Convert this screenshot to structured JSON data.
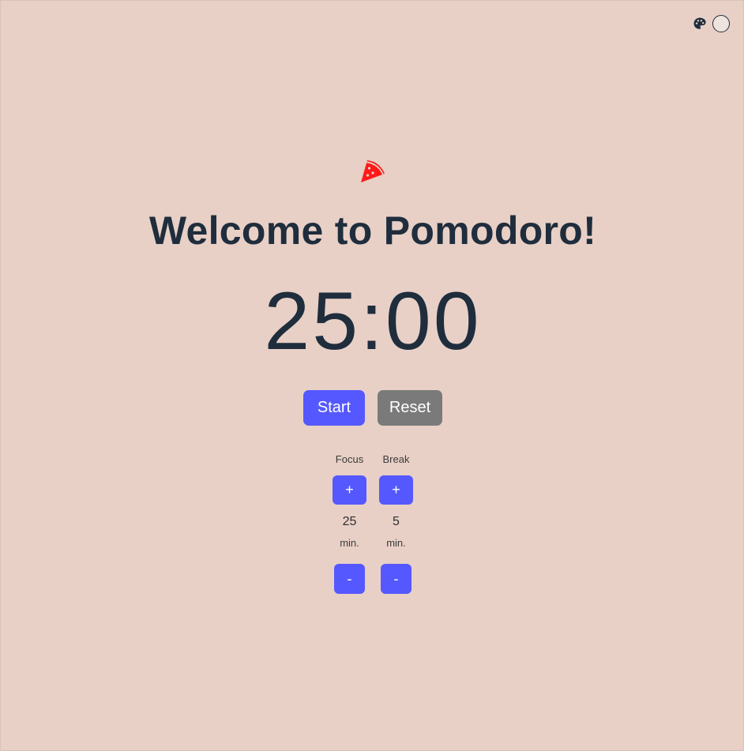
{
  "header": {
    "icons": {
      "palette": "palette-icon",
      "theme": "theme-toggle"
    }
  },
  "logo": {
    "icon": "pizza-slice-icon",
    "color": "#ff1a1a"
  },
  "title": "Welcome to Pomodoro!",
  "timer": {
    "display": "25:00"
  },
  "controls": {
    "start_label": "Start",
    "reset_label": "Reset"
  },
  "settings": {
    "focus": {
      "label": "Focus",
      "increment_label": "+",
      "value": "25",
      "unit": "min.",
      "decrement_label": "-"
    },
    "break": {
      "label": "Break",
      "increment_label": "+",
      "value": "5",
      "unit": "min.",
      "decrement_label": "-"
    }
  },
  "colors": {
    "background": "#e8d0c6",
    "accent": "#5558ff",
    "reset": "#7a7a7a",
    "text": "#1f2d3d"
  }
}
